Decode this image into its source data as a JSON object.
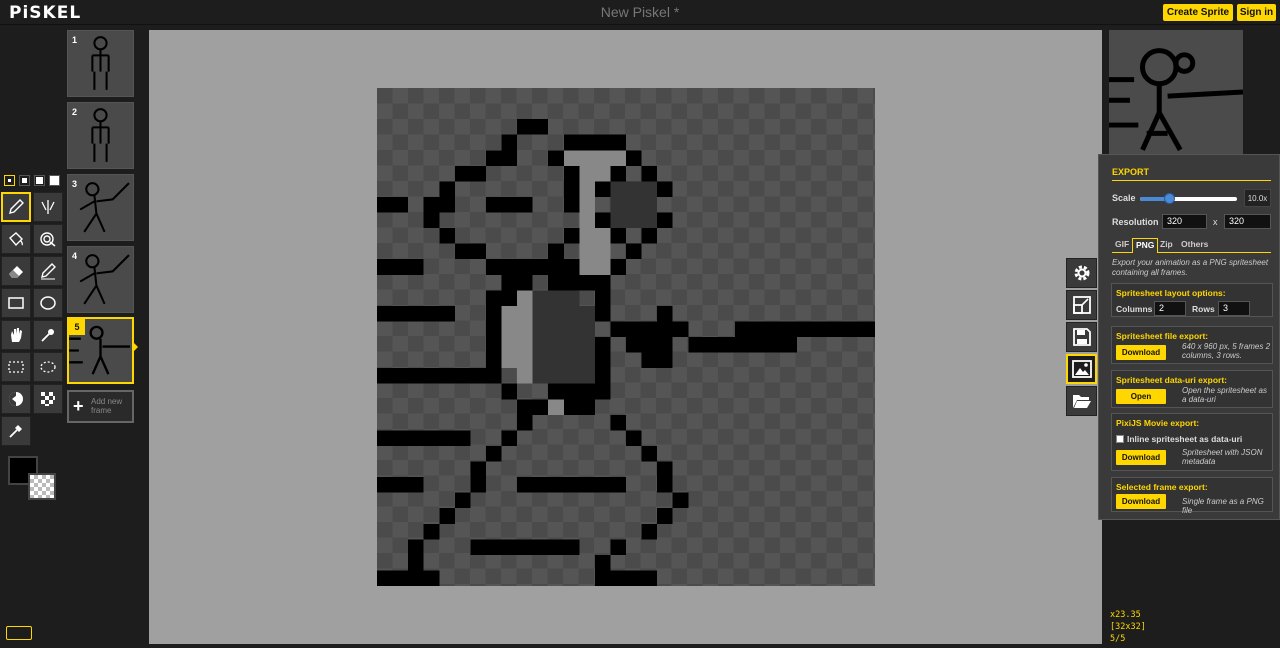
{
  "app": {
    "logo": "PiSKEL",
    "title": "New Piskel *",
    "create_sprite": "Create Sprite",
    "sign_in": "Sign in"
  },
  "tools": [
    "pen-icon",
    "vertical-mirror-pen-icon",
    "paint-bucket-icon",
    "paint-same-color-icon",
    "eraser-icon",
    "stroke-icon",
    "rectangle-icon",
    "circle-icon",
    "move-icon",
    "shape-selection-icon",
    "rectangle-selection-icon",
    "lasso-selection-icon",
    "lighten-icon",
    "dithering-icon",
    "color-picker-icon"
  ],
  "frames": [
    {
      "number": "1"
    },
    {
      "number": "2"
    },
    {
      "number": "3"
    },
    {
      "number": "4"
    },
    {
      "number": "5",
      "selected": true
    }
  ],
  "add_frame": "Add new frame",
  "colors": {
    "primary": "#000000",
    "accent": "#ffd700"
  },
  "export": {
    "title": "EXPORT",
    "scale_label": "Scale",
    "scale_value": "10.0x",
    "scale_fraction": 0.3,
    "resolution_label": "Resolution",
    "width": "320",
    "x": "x",
    "height": "320",
    "tabs": [
      "GIF",
      "PNG",
      "Zip",
      "Others"
    ],
    "selected_tab": "PNG",
    "description": "Export your animation as a PNG spritesheet containing all frames.",
    "layout": {
      "title": "Spritesheet layout options:",
      "columns_label": "Columns",
      "columns": "2",
      "rows_label": "Rows",
      "rows": "3"
    },
    "file_export": {
      "title": "Spritesheet file export:",
      "button": "Download",
      "desc": "640 x 960 px, 5 frames 2 columns, 3 rows."
    },
    "datauri_export": {
      "title": "Spritesheet data-uri export:",
      "button": "Open",
      "desc": "Open the spritesheet as a data-uri"
    },
    "pixi_export": {
      "title": "PixiJS Movie export:",
      "checkbox_label": "Inline spritesheet as data-uri",
      "button": "Download",
      "desc": "Spritesheet with JSON metadata"
    },
    "frame_export": {
      "title": "Selected frame export:",
      "button": "Download",
      "desc": "Single frame as a PNG file"
    }
  },
  "status": {
    "zoom": "x23.35",
    "size": "[32x32]",
    "frame": "5/5"
  }
}
